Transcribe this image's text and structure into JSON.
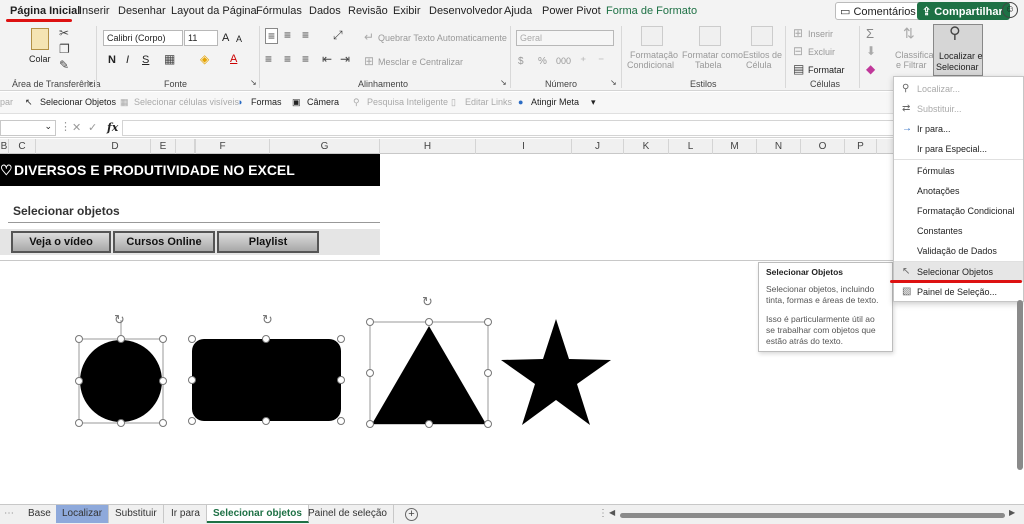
{
  "menu": {
    "tabs": [
      "Página Inicial",
      "Inserir",
      "Desenhar",
      "Layout da Página",
      "Fórmulas",
      "Dados",
      "Revisão",
      "Exibir",
      "Desenvolvedor",
      "Ajuda",
      "Power Pivot",
      "Forma de Formato"
    ],
    "comments_label": "Comentários",
    "share_label": "Compartilhar"
  },
  "ribbon": {
    "clipboard": {
      "paste": "Colar",
      "group": "Área de Transferência"
    },
    "font": {
      "name": "Calibri (Corpo)",
      "size": "11",
      "bold": "N",
      "italic": "I",
      "underline": "S",
      "grow": "A",
      "shrink": "A",
      "color": "A",
      "group": "Fonte"
    },
    "alignment": {
      "wrap": "Quebrar Texto Automaticamente",
      "merge": "Mesclar e Centralizar",
      "group": "Alinhamento"
    },
    "number": {
      "format": "Geral",
      "currency": "$",
      "percent": "%",
      "thousands": "000",
      "group": "Número"
    },
    "styles": {
      "conditional_1": "Formatação",
      "conditional_2": "Condicional",
      "table_1": "Formatar como",
      "table_2": "Tabela",
      "cell_1": "Estilos de",
      "cell_2": "Célula",
      "group": "Estilos"
    },
    "cells": {
      "insert": "Inserir",
      "delete": "Excluir",
      "format": "Formatar",
      "group": "Células"
    },
    "editing": {
      "sigma": "Σ",
      "sort_1": "Classificar",
      "sort_2": "e Filtrar",
      "find_1": "Localizar e",
      "find_2": "Selecionar"
    }
  },
  "qat": {
    "clip": "par",
    "select_objects": "Selecionar Objetos",
    "select_visible": "Selecionar células visíveis",
    "shapes": "Formas",
    "camera": "Câmera",
    "smart_search": "Pesquisa Inteligente",
    "edit_links": "Editar Links",
    "goal_seek": "Atingir Meta"
  },
  "formula_bar": {
    "fx": "fx",
    "cancel": "✕",
    "enter": "✓",
    "more": "⋮"
  },
  "columns": [
    "B",
    "C",
    "D",
    "E",
    "F",
    "G",
    "H",
    "I",
    "J",
    "K",
    "L",
    "M",
    "N",
    "O",
    "P"
  ],
  "sheet": {
    "banner_title": "DIVERSOS E PRODUTIVIDADE NO EXCEL",
    "subtitle": "Selecionar objetos",
    "buttons": [
      "Veja o vídeo",
      "Cursos Online",
      "Playlist"
    ]
  },
  "dropdown": {
    "items": [
      "Localizar...",
      "Substituir...",
      "Ir para...",
      "Ir para Especial...",
      "Fórmulas",
      "Anotações",
      "Formatação Condicional",
      "Constantes",
      "Validação de Dados",
      "Selecionar Objetos",
      "Painel de Seleção..."
    ]
  },
  "tooltip": {
    "title": "Selecionar Objetos",
    "p1": "Selecionar objetos, incluindo tinta, formas e áreas de texto.",
    "p2": "Isso é particularmente útil ao se trabalhar com objetos que estão atrás do texto."
  },
  "sheet_tabs": [
    "Base",
    "Localizar",
    "Substituir",
    "Ir para",
    "Selecionar objetos",
    "Painel de seleção"
  ],
  "colors": {
    "excel_green": "#1e7145",
    "red_marker": "#dd1111",
    "blue_tab": "#8ea9db"
  },
  "icons": [
    "paste-icon",
    "cut-icon",
    "copy-icon",
    "format-painter-icon",
    "search-icon",
    "cursor-icon",
    "shapes-icon",
    "camera-icon",
    "smiley-icon",
    "add-sheet-icon"
  ]
}
